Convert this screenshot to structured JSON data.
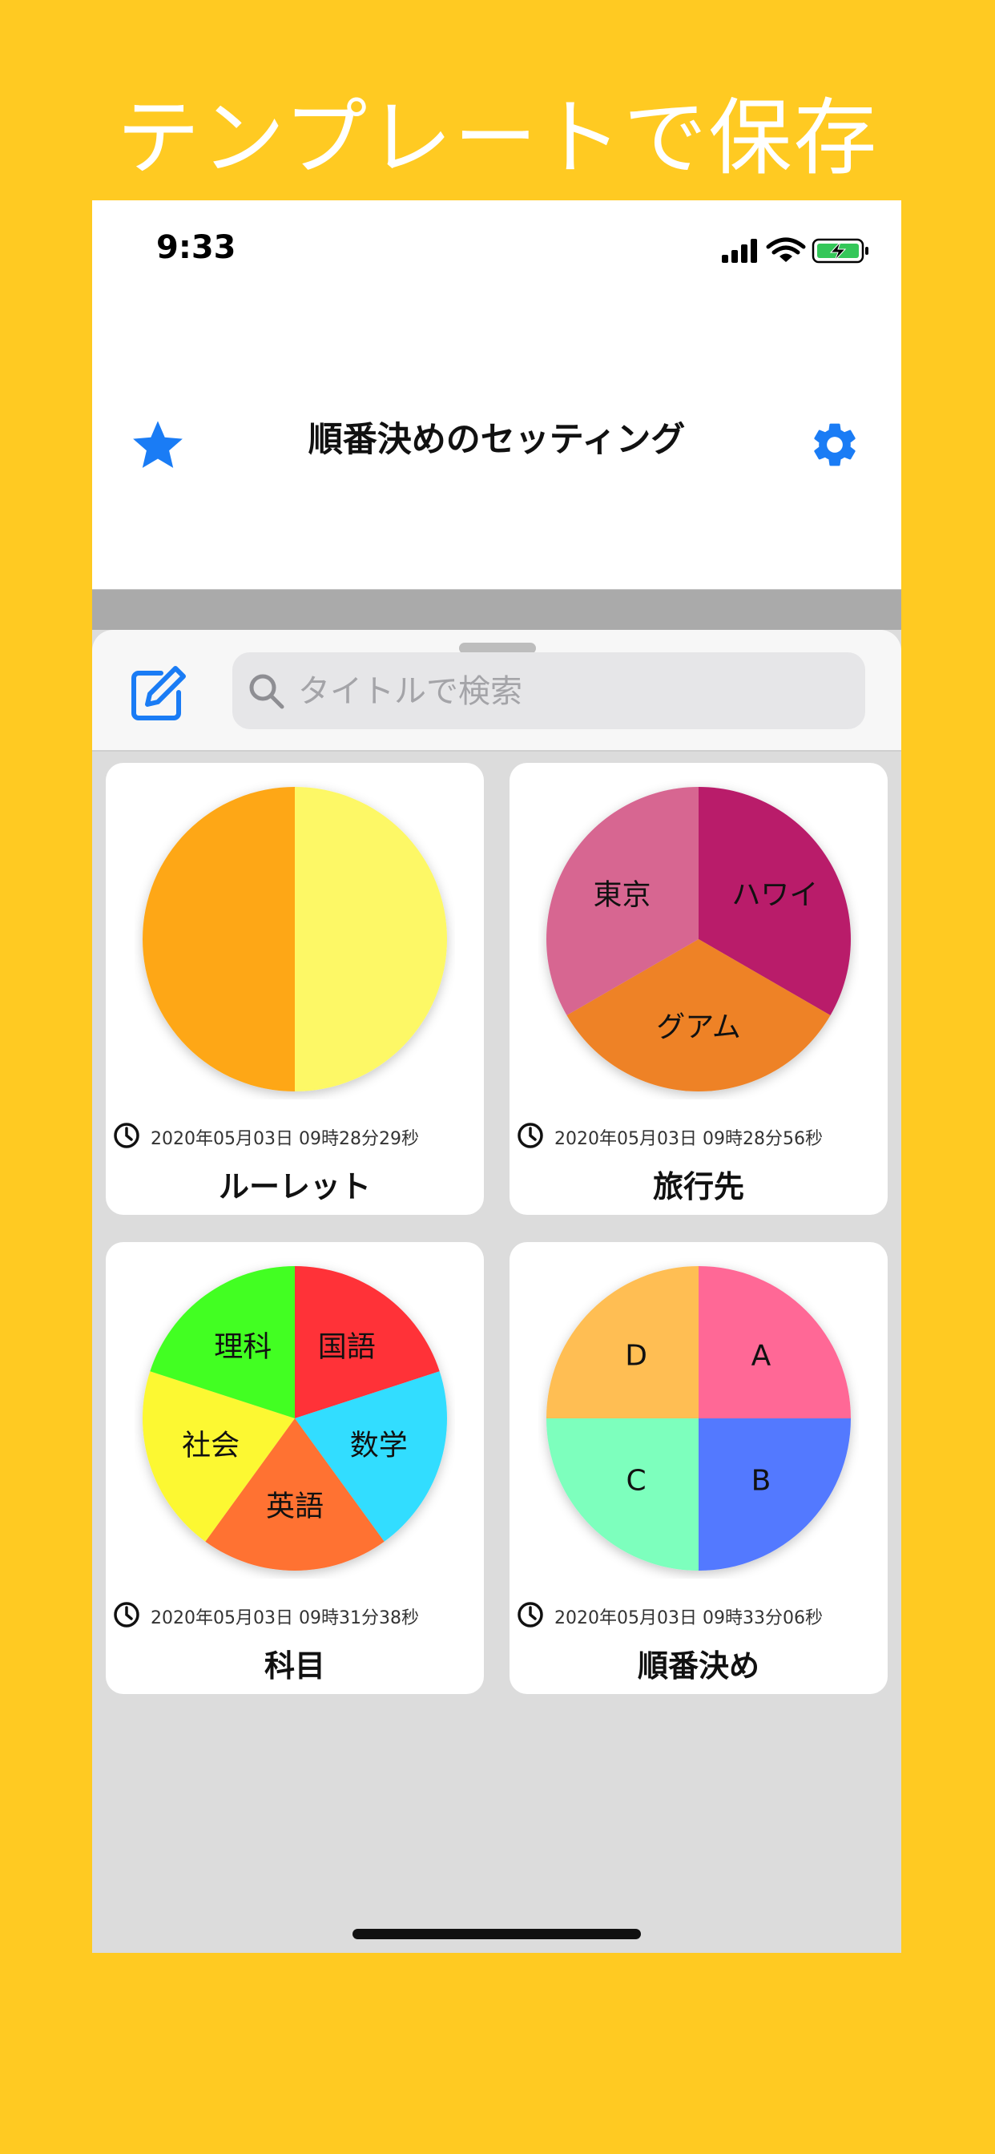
{
  "colors": {
    "background": "#ffca22",
    "accent": "#1a7cf5",
    "promo_text": "#ffffff"
  },
  "promo": {
    "headline": "テンプレートで保存"
  },
  "status_bar": {
    "time": "9:33",
    "icons": [
      "signal-icon",
      "wifi-icon",
      "battery-charging-icon"
    ]
  },
  "nav": {
    "title": "順番決めのセッティング",
    "left_icon": "star-icon",
    "right_icon": "gear-icon"
  },
  "search": {
    "placeholder": "タイトルで検索",
    "value": ""
  },
  "cards": [
    {
      "title": "ルーレット",
      "date": "2020年05月03日 09時28分29秒",
      "slices": [
        {
          "label": "",
          "color": "#fdf866",
          "value": 1
        },
        {
          "label": "",
          "color": "#fea715",
          "value": 1
        }
      ]
    },
    {
      "title": "旅行先",
      "date": "2020年05月03日 09時28分56秒",
      "slices": [
        {
          "label": "ハワイ",
          "color": "#b91b6b",
          "value": 1
        },
        {
          "label": "グアム",
          "color": "#ee8225",
          "value": 1
        },
        {
          "label": "東京",
          "color": "#d76691",
          "value": 1
        }
      ]
    },
    {
      "title": "科目",
      "date": "2020年05月03日 09時31分38秒",
      "slices": [
        {
          "label": "国語",
          "color": "#ff3038",
          "value": 1
        },
        {
          "label": "数学",
          "color": "#32ddff",
          "value": 1
        },
        {
          "label": "英語",
          "color": "#ff7233",
          "value": 1
        },
        {
          "label": "社会",
          "color": "#fcf832",
          "value": 1
        },
        {
          "label": "理科",
          "color": "#43ff22",
          "value": 1
        }
      ]
    },
    {
      "title": "順番決め",
      "date": "2020年05月03日 09時33分06秒",
      "slices": [
        {
          "label": "A",
          "color": "#ff6796",
          "value": 1
        },
        {
          "label": "B",
          "color": "#5379ff",
          "value": 1
        },
        {
          "label": "C",
          "color": "#7dffbd",
          "value": 1
        },
        {
          "label": "D",
          "color": "#ffbe53",
          "value": 1
        }
      ]
    }
  ]
}
